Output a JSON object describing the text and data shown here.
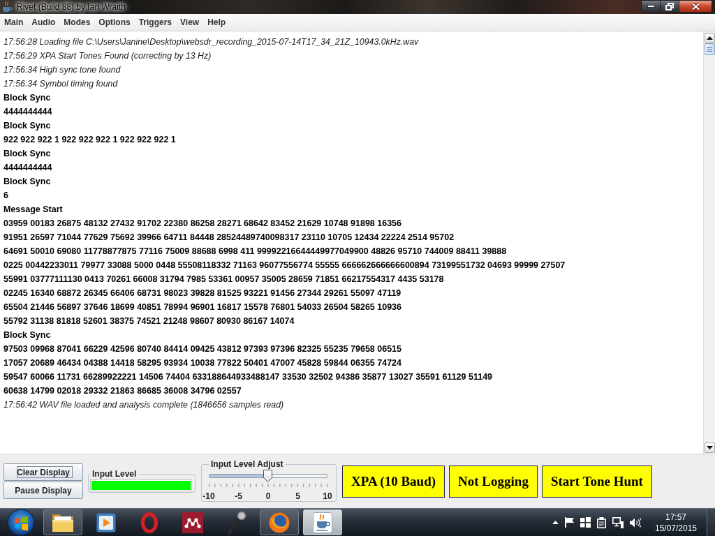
{
  "window": {
    "title": "Rivet (Build 88) by Ian Wraith"
  },
  "menu": [
    "Main",
    "Audio",
    "Modes",
    "Options",
    "Triggers",
    "View",
    "Help"
  ],
  "log": [
    {
      "kind": "event",
      "text": "17:56:28 Loading file C:\\Users\\Janine\\Desktop\\websdr_recording_2015-07-14T17_34_21Z_10943.0kHz.wav"
    },
    {
      "kind": "event",
      "text": "17:56:29 XPA Start Tones Found (correcting by 13 Hz)"
    },
    {
      "kind": "event",
      "text": "17:56:34 High sync tone found"
    },
    {
      "kind": "event",
      "text": "17:56:34 Symbol timing found"
    },
    {
      "kind": "data",
      "text": "Block Sync"
    },
    {
      "kind": "data",
      "text": "4444444444"
    },
    {
      "kind": "data",
      "text": "Block Sync"
    },
    {
      "kind": "data",
      "text": "922 922 922 1 922 922 922 1 922 922 922 1"
    },
    {
      "kind": "data",
      "text": "Block Sync"
    },
    {
      "kind": "data",
      "text": "4444444444"
    },
    {
      "kind": "data",
      "text": "Block Sync"
    },
    {
      "kind": "data",
      "text": "6"
    },
    {
      "kind": "data",
      "text": "Message Start"
    },
    {
      "kind": "data",
      "text": "03959 00183 26875 48132 27432 91702 22380 86258 28271 68642 83452 21629 10748 91898 16356"
    },
    {
      "kind": "data",
      "text": "91951 26597 71044 77629 75692 39966 64711 84448 28524489740098317 23110 10705 12434 22224 2514 95702"
    },
    {
      "kind": "data",
      "text": "64691 50010 69080 11778877875 77116 75009 88688 6998 411 99992216644449977049900 48826 95710 744009 88411 39888"
    },
    {
      "kind": "data",
      "text": "0225 00442233011 79977 33088 5000 0448 55508118332 71163 96077556774 55555 666662666666600894 73199551732 04693 99999 27507"
    },
    {
      "kind": "data",
      "text": "55991 03777111130 0413 70261 66008 31794 7985 53361 00957 35005 28659 71851 66217554317 4435 53178"
    },
    {
      "kind": "data",
      "text": "02245 16340 68872 26345 66406 68731 98023 39828 81525 93221 91456 27344 29261 55097 47119"
    },
    {
      "kind": "data",
      "text": "65504 21446 56897 37646 18699 40851 78994 96901 16817 15578 76801 54033 26504 58265 10936"
    },
    {
      "kind": "data",
      "text": "55792 31138 81818 52601 38375 74521 21248 98607 80930 86167 14074"
    },
    {
      "kind": "data",
      "text": "Block Sync"
    },
    {
      "kind": "data",
      "text": "97503 09968 87041 66229 42596 80740 84414 09425 43812 97393 97396 82325 55235 79658 06515"
    },
    {
      "kind": "data",
      "text": "17057 20689 46434 04388 14418 58295 93934 10038 77822 50401 47007 45828 59844 06355 74724"
    },
    {
      "kind": "data",
      "text": "59547 60066 11731 66289922221 14506 74404 633188644933488147 33530 32502 94386 35877 13027 35591 61129 51149"
    },
    {
      "kind": "data",
      "text": "60638 14799 02018 29332 21863 86685 36008 34796 02557"
    },
    {
      "kind": "event",
      "text": "17:56:42 WAV file loaded and analysis complete (1846656 samples read)"
    }
  ],
  "controls": {
    "buttons": [
      {
        "label": "Clear Display",
        "focused": true
      },
      {
        "label": "Pause Display",
        "focused": false
      }
    ],
    "input_level": {
      "label": "Input Level",
      "level": 1
    },
    "input_level_adjust": {
      "label": "Input Level Adjust",
      "level": 0.5,
      "tick_labels": [
        "-10",
        "-5",
        "0",
        "5",
        "10"
      ]
    },
    "mode_buttons": [
      "XPA (10 Baud)",
      "Not Logging",
      "Start Tone Hunt"
    ]
  },
  "taskbar": {
    "apps": [
      {
        "kind": "folder",
        "running": true,
        "selected": false
      },
      {
        "kind": "media",
        "running": false,
        "selected": false
      },
      {
        "kind": "ring",
        "running": false,
        "selected": false
      },
      {
        "kind": "dots",
        "running": false,
        "selected": false
      },
      {
        "kind": "microphone",
        "running": false,
        "selected": false
      },
      {
        "kind": "globe",
        "running": true,
        "selected": false
      },
      {
        "kind": "cup",
        "running": true,
        "selected": true
      }
    ],
    "clock": {
      "time": "17:57",
      "date": "15/07/2015"
    }
  }
}
